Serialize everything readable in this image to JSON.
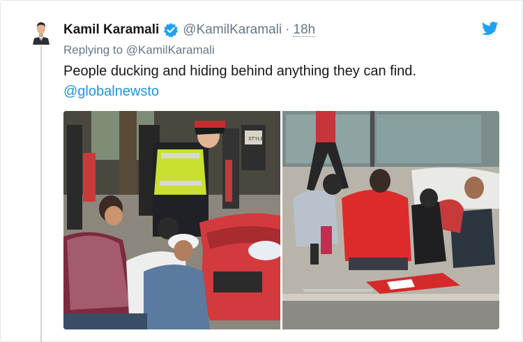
{
  "tweet": {
    "author_name": "Kamil Karamali",
    "author_handle": "@KamilKaramali",
    "separator": "·",
    "time": "18h",
    "reply_prefix": "Replying to",
    "reply_to": "@KamilKaramali",
    "text": "People ducking and hiding behind anything they can find.",
    "mention": "@globalnewsto",
    "store_sign": "STYLE"
  },
  "icons": {
    "verified": "verified-badge-icon",
    "brand": "twitter-bird-icon"
  },
  "colors": {
    "name": "#14171a",
    "meta": "#657786",
    "link": "#1b95e0",
    "verified": "#1da1f2",
    "thread_line": "#ccd6dd"
  }
}
